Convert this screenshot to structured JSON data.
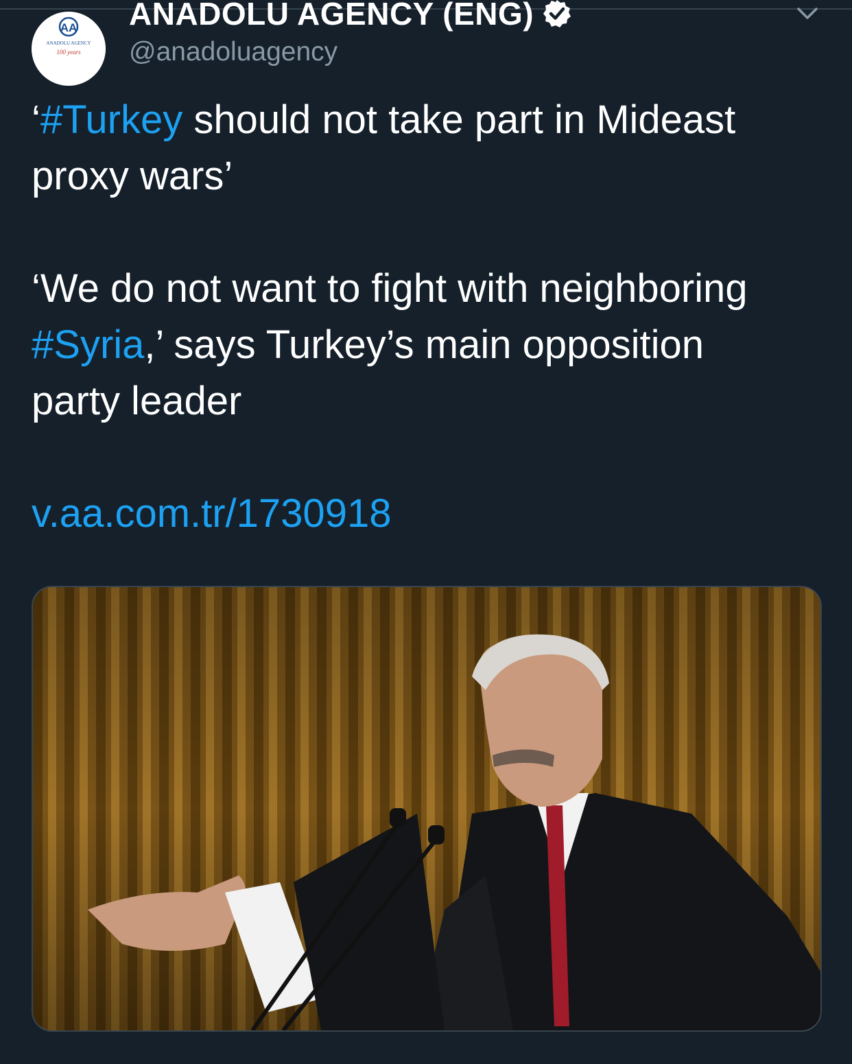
{
  "tweet": {
    "author": {
      "display_name": "ANADOLU AGENCY (ENG)",
      "handle": "@anadoluagency",
      "verified": true,
      "avatar": {
        "logo_text": "AA",
        "org_text": "ANADOLU AGENCY",
        "anniversary_text": "100 years"
      }
    },
    "menu_icon": "chevron-down-icon",
    "text": {
      "line1": {
        "open_quote": "‘",
        "hashtag": "#Turkey",
        "rest": " should not take part in Mideast"
      },
      "line2": "proxy wars’",
      "line3": "‘We do not want to fight with neighboring",
      "line4": {
        "hashtag": "#Syria",
        "rest": ",’ says Turkey’s main opposition"
      },
      "line5": "party leader",
      "link": "v.aa.com.tr/1730918"
    },
    "media": {
      "type": "photo",
      "description": "photo"
    }
  },
  "colors": {
    "background": "#15202b",
    "text": "#ffffff",
    "secondary_text": "#8899a6",
    "link": "#1da1f2",
    "divider": "#38444d"
  }
}
